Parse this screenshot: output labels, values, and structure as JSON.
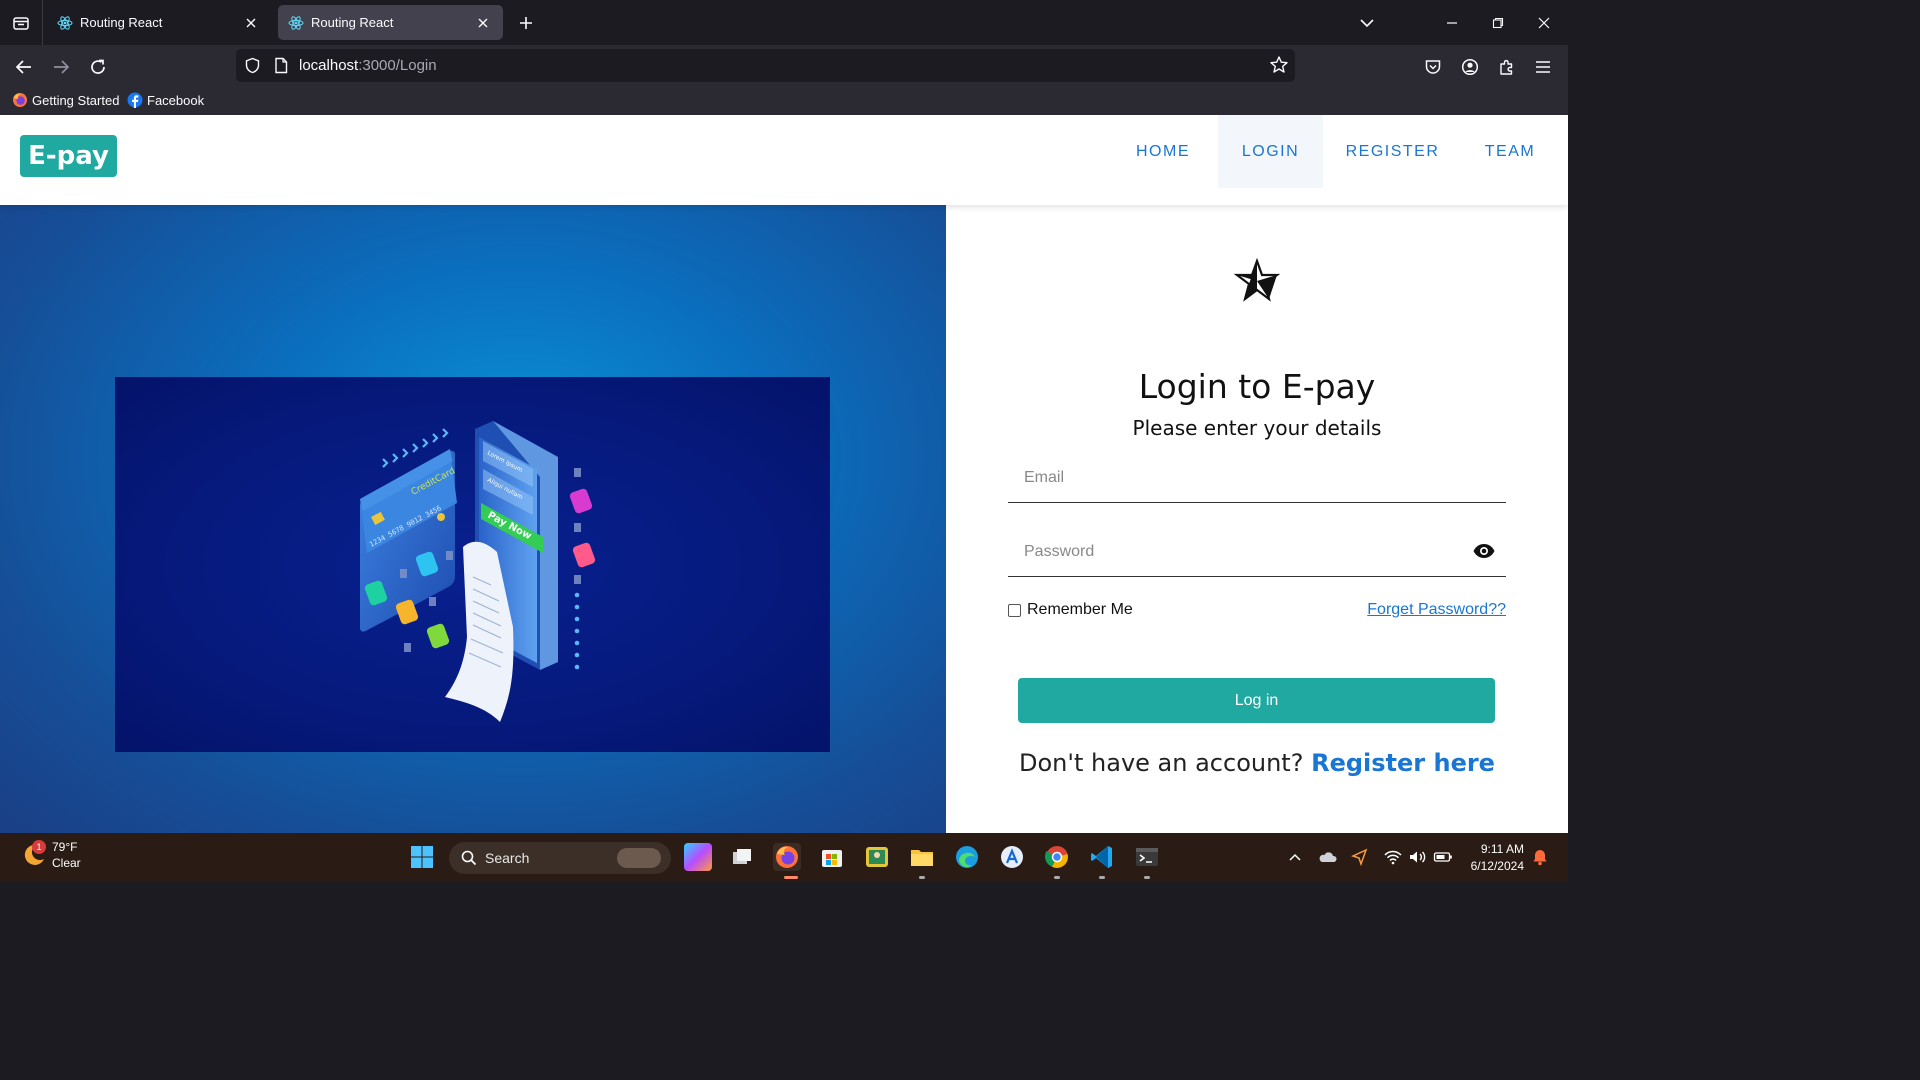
{
  "browser": {
    "tabs": [
      {
        "title": "Routing React",
        "active": false
      },
      {
        "title": "Routing React",
        "active": true
      }
    ],
    "url": {
      "host": "localhost",
      "path": ":3000/Login"
    },
    "bookmarks": [
      {
        "label": "Getting Started",
        "icon": "firefox-icon"
      },
      {
        "label": "Facebook",
        "icon": "facebook-icon"
      }
    ]
  },
  "app": {
    "logo": "E-pay",
    "menu": [
      {
        "label": "HOME",
        "active": false
      },
      {
        "label": "LOGIN",
        "active": true
      },
      {
        "label": "REGISTER",
        "active": false
      },
      {
        "label": "TEAM",
        "active": false
      }
    ],
    "illustration": {
      "card_text": "CreditCard",
      "card_number": "1234 5678 9012 3456",
      "button_text": "Pay Now",
      "screen_lines": [
        "Lorem ipsum",
        "Aliqui nullam"
      ]
    },
    "login": {
      "title": "Login to E-pay",
      "subtitle": "Please enter your details",
      "email_placeholder": "Email",
      "password_placeholder": "Password",
      "remember_label": "Remember Me",
      "forgot_label": "Forget Password??",
      "submit_label": "Log in",
      "signup_prompt": "Don't have an account?",
      "signup_link": "Register here"
    }
  },
  "taskbar": {
    "weather": {
      "temp": "79°F",
      "condition": "Clear",
      "badge": "1"
    },
    "search_placeholder": "Search",
    "time": "9:11 AM",
    "date": "6/12/2024"
  },
  "colors": {
    "brand": "#1fa9a0",
    "link": "#1976d2"
  }
}
